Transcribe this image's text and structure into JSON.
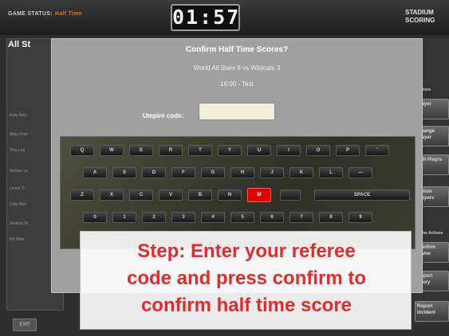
{
  "header": {
    "status_label": "GAME STATUS:",
    "status_value": "Half Time",
    "clock": "01:57",
    "brand_line1": "STADIUM",
    "brand_line2": "SCORING"
  },
  "left_panel": {
    "title": "All St",
    "ghost_rows": [
      "Kate Rou",
      "Mary Fran",
      "Tina Leg",
      "Nathan Le",
      "Lionel Ti",
      "Cole Hen",
      "Jessica St",
      "Bri Wille"
    ]
  },
  "right_panel": {
    "section1": "Actions",
    "buttons1": [
      "Player",
      "Change Player",
      "Edit Playrs",
      "Action Players"
    ],
    "section2": "Game Actions",
    "buttons2": [
      "Confirm Game",
      "Report Injury",
      "Report Incident"
    ]
  },
  "bottom": {
    "exit_label": "EXIT"
  },
  "modal": {
    "title": "Confirm Half Time Scores?",
    "match": "World All Stars 6 vs Wildcats 3",
    "time": "16:00 - Test",
    "umpire_label": "Umpire code:",
    "umpire_value": ""
  },
  "keyboard": {
    "row1": [
      "Q",
      "W",
      "E",
      "R",
      "T",
      "Y",
      "U",
      "I",
      "O",
      "P",
      "'"
    ],
    "row2": [
      "A",
      "S",
      "D",
      "F",
      "G",
      "H",
      "J",
      "K",
      "L",
      "—"
    ],
    "row3": [
      "Z",
      "X",
      "C",
      "V",
      "B",
      "N",
      "M",
      "",
      "SPACE"
    ],
    "row4": [
      "0",
      "1",
      "2",
      "3",
      "4",
      "5",
      "6",
      "7",
      "8",
      "9"
    ],
    "active_key": "M",
    "active_color": "#e00000"
  },
  "callout": {
    "line1": "Step: Enter your referee",
    "line2": "code and press confirm to",
    "line3": "confirm half time score",
    "text_color": "#e32b2b"
  }
}
